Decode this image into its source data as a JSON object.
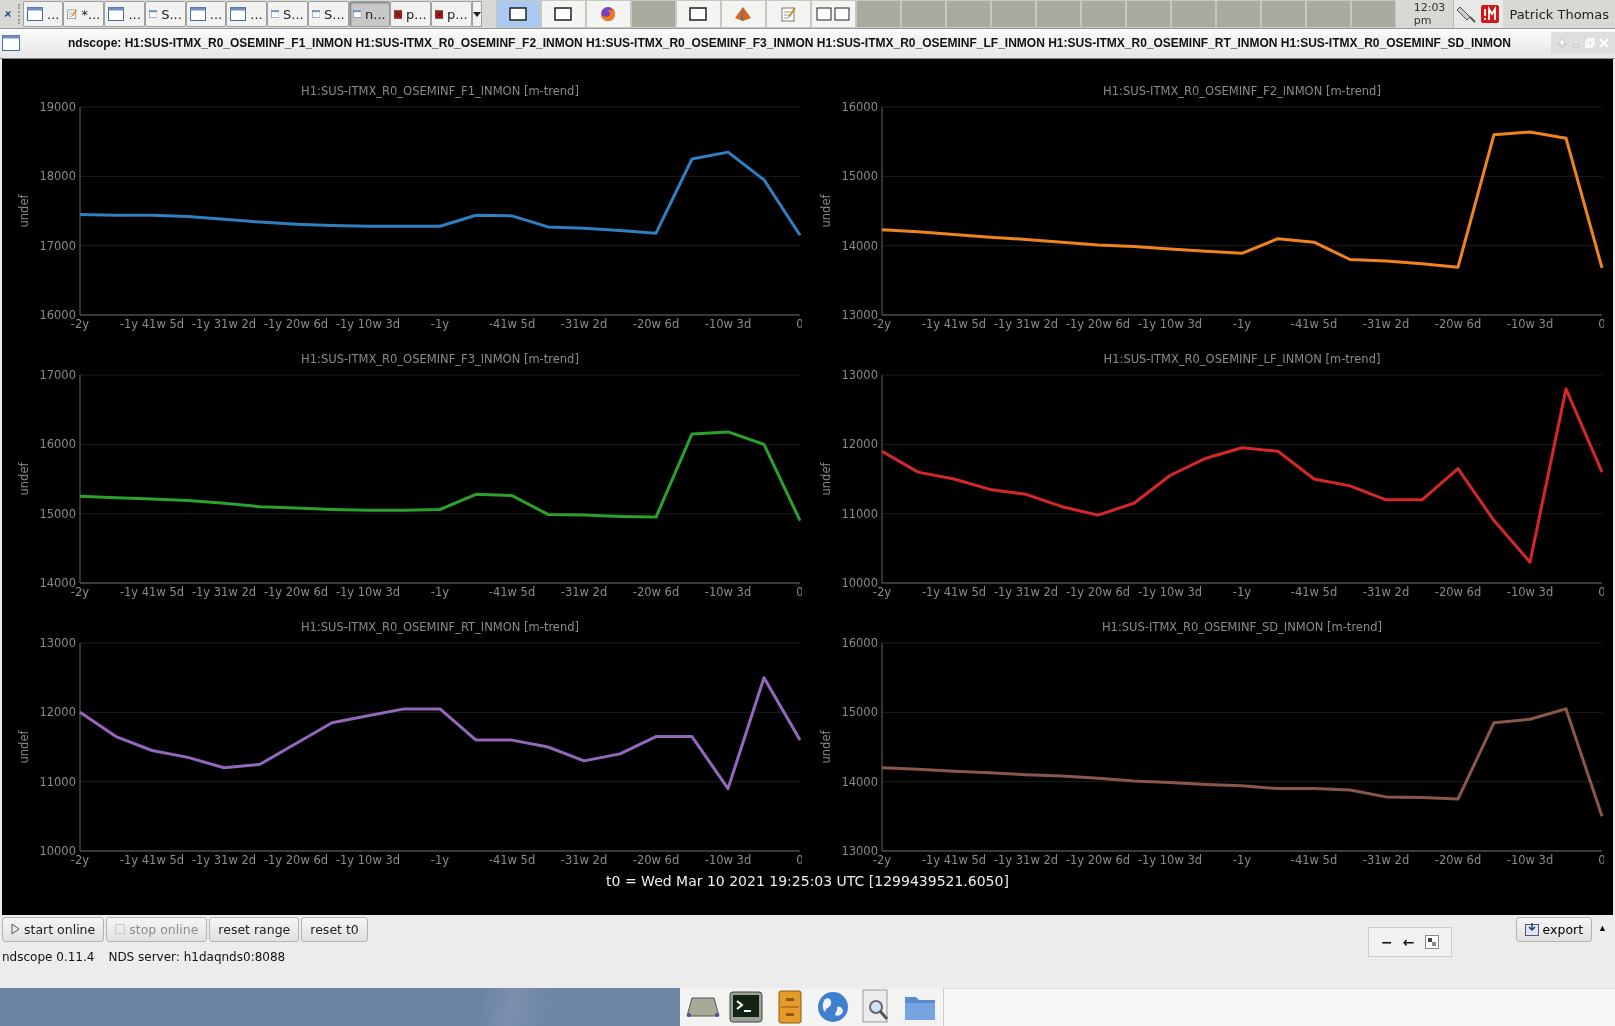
{
  "taskbar": {
    "tasks": [
      {
        "label": "...",
        "kind": "window",
        "selected": false
      },
      {
        "label": "*...",
        "kind": "editor",
        "selected": false
      },
      {
        "label": "...",
        "kind": "window",
        "selected": false
      },
      {
        "label": "S...",
        "kind": "window",
        "selected": false
      },
      {
        "label": "...",
        "kind": "window",
        "selected": false
      },
      {
        "label": "...",
        "kind": "window",
        "selected": false
      },
      {
        "label": "S...",
        "kind": "window",
        "selected": false
      },
      {
        "label": "S...",
        "kind": "window",
        "selected": false
      },
      {
        "label": "n...",
        "kind": "window",
        "selected": true
      },
      {
        "label": "p...",
        "kind": "terminal",
        "selected": false
      },
      {
        "label": "p...",
        "kind": "terminal",
        "selected": false
      }
    ],
    "workspaces": [
      {
        "kind": "window",
        "selected": true
      },
      {
        "kind": "window",
        "selected": false
      },
      {
        "kind": "browser",
        "selected": false
      },
      {
        "kind": "empty",
        "selected": false
      },
      {
        "kind": "window",
        "selected": false
      },
      {
        "kind": "cone",
        "selected": false
      },
      {
        "kind": "editor",
        "selected": false
      },
      {
        "kind": "two-windows",
        "selected": false
      },
      {
        "kind": "empty",
        "selected": false
      },
      {
        "kind": "empty",
        "selected": false
      },
      {
        "kind": "empty",
        "selected": false
      },
      {
        "kind": "empty",
        "selected": false
      },
      {
        "kind": "empty",
        "selected": false
      },
      {
        "kind": "empty",
        "selected": false
      },
      {
        "kind": "empty",
        "selected": false
      },
      {
        "kind": "empty",
        "selected": false
      },
      {
        "kind": "empty",
        "selected": false
      },
      {
        "kind": "empty",
        "selected": false
      },
      {
        "kind": "empty",
        "selected": false
      },
      {
        "kind": "empty",
        "selected": false
      }
    ],
    "clock": "12:03 pm",
    "user": "Patrick Thomas"
  },
  "window": {
    "title": "ndscope: H1:SUS-ITMX_R0_OSEMINF_F1_INMON H1:SUS-ITMX_R0_OSEMINF_F2_INMON H1:SUS-ITMX_R0_OSEMINF_F3_INMON H1:SUS-ITMX_R0_OSEMINF_LF_INMON H1:SUS-ITMX_R0_OSEMINF_RT_INMON H1:SUS-ITMX_R0_OSEMINF_SD_INMON"
  },
  "plots": [
    {
      "chart_data": {
        "type": "line",
        "title": "H1:SUS-ITMX_R0_OSEMINF_F1_INMON [m-trend]",
        "ylabel": "undef",
        "categories": [
          "-2y",
          null,
          "-1y 41w 5d",
          null,
          "-1y 31w 2d",
          null,
          "-1y 20w 6d",
          null,
          "-1y 10w 3d",
          null,
          "-1y",
          null,
          "-41w 5d",
          null,
          "-31w 2d",
          null,
          "-20w 6d",
          null,
          "-10w 3d",
          null,
          "0"
        ],
        "ylim": [
          16000,
          19000
        ],
        "yticks": [
          16000,
          17000,
          18000,
          19000
        ],
        "series": [
          {
            "color": "#2f7fc1",
            "values": [
              17450,
              17440,
              17440,
              17420,
              17380,
              17340,
              17310,
              17290,
              17280,
              17280,
              17280,
              17440,
              17430,
              17270,
              17250,
              17220,
              17180,
              18250,
              18350,
              17950,
              17150
            ]
          }
        ]
      }
    },
    {
      "chart_data": {
        "type": "line",
        "title": "H1:SUS-ITMX_R0_OSEMINF_F2_INMON [m-trend]",
        "ylabel": "undef",
        "categories": [
          "-2y",
          null,
          "-1y 41w 5d",
          null,
          "-1y 31w 2d",
          null,
          "-1y 20w 6d",
          null,
          "-1y 10w 3d",
          null,
          "-1y",
          null,
          "-41w 5d",
          null,
          "-31w 2d",
          null,
          "-20w 6d",
          null,
          "-10w 3d",
          null,
          "0"
        ],
        "ylim": [
          13000,
          16000
        ],
        "yticks": [
          13000,
          14000,
          15000,
          16000
        ],
        "series": [
          {
            "color": "#f0841c",
            "values": [
              14230,
              14200,
              14160,
              14120,
              14090,
              14050,
              14010,
              13990,
              13950,
              13920,
              13890,
              14100,
              14050,
              13800,
              13780,
              13740,
              13690,
              15600,
              15640,
              15550,
              13680
            ]
          }
        ]
      }
    },
    {
      "chart_data": {
        "type": "line",
        "title": "H1:SUS-ITMX_R0_OSEMINF_F3_INMON [m-trend]",
        "ylabel": "undef",
        "categories": [
          "-2y",
          null,
          "-1y 41w 5d",
          null,
          "-1y 31w 2d",
          null,
          "-1y 20w 6d",
          null,
          "-1y 10w 3d",
          null,
          "-1y",
          null,
          "-41w 5d",
          null,
          "-31w 2d",
          null,
          "-20w 6d",
          null,
          "-10w 3d",
          null,
          "0"
        ],
        "ylim": [
          14000,
          17000
        ],
        "yticks": [
          14000,
          15000,
          16000,
          17000
        ],
        "series": [
          {
            "color": "#2ca02c",
            "values": [
              15250,
              15230,
              15210,
              15190,
              15150,
              15100,
              15080,
              15060,
              15050,
              15050,
              15060,
              15280,
              15260,
              14990,
              14980,
              14960,
              14950,
              16150,
              16180,
              16000,
              14900
            ]
          }
        ]
      }
    },
    {
      "chart_data": {
        "type": "line",
        "title": "H1:SUS-ITMX_R0_OSEMINF_LF_INMON [m-trend]",
        "ylabel": "undef",
        "categories": [
          "-2y",
          null,
          "-1y 41w 5d",
          null,
          "-1y 31w 2d",
          null,
          "-1y 20w 6d",
          null,
          "-1y 10w 3d",
          null,
          "-1y",
          null,
          "-41w 5d",
          null,
          "-31w 2d",
          null,
          "-20w 6d",
          null,
          "-10w 3d",
          null,
          "0"
        ],
        "ylim": [
          10000,
          13000
        ],
        "yticks": [
          10000,
          11000,
          12000,
          13000
        ],
        "series": [
          {
            "color": "#d62728",
            "values": [
              11900,
              11600,
              11500,
              11350,
              11280,
              11100,
              10980,
              11150,
              11550,
              11800,
              11950,
              11900,
              11500,
              11400,
              11200,
              11200,
              11650,
              10900,
              10300,
              12800,
              11600
            ]
          }
        ]
      }
    },
    {
      "chart_data": {
        "type": "line",
        "title": "H1:SUS-ITMX_R0_OSEMINF_RT_INMON [m-trend]",
        "ylabel": "undef",
        "categories": [
          "-2y",
          null,
          "-1y 41w 5d",
          null,
          "-1y 31w 2d",
          null,
          "-1y 20w 6d",
          null,
          "-1y 10w 3d",
          null,
          "-1y",
          null,
          "-41w 5d",
          null,
          "-31w 2d",
          null,
          "-20w 6d",
          null,
          "-10w 3d",
          null,
          "0"
        ],
        "ylim": [
          10000,
          13000
        ],
        "yticks": [
          10000,
          11000,
          12000,
          13000
        ],
        "series": [
          {
            "color": "#9467bd",
            "values": [
              12000,
              11650,
              11450,
              11350,
              11200,
              11250,
              11550,
              11850,
              11950,
              12050,
              12050,
              11600,
              11600,
              11500,
              11300,
              11400,
              11650,
              11650,
              10900,
              12500,
              11600
            ]
          }
        ]
      }
    },
    {
      "chart_data": {
        "type": "line",
        "title": "H1:SUS-ITMX_R0_OSEMINF_SD_INMON [m-trend]",
        "ylabel": "undef",
        "categories": [
          "-2y",
          null,
          "-1y 41w 5d",
          null,
          "-1y 31w 2d",
          null,
          "-1y 20w 6d",
          null,
          "-1y 10w 3d",
          null,
          "-1y",
          null,
          "-41w 5d",
          null,
          "-31w 2d",
          null,
          "-20w 6d",
          null,
          "-10w 3d",
          null,
          "0"
        ],
        "ylim": [
          13000,
          16000
        ],
        "yticks": [
          13000,
          14000,
          15000,
          16000
        ],
        "series": [
          {
            "color": "#8c564b",
            "values": [
              14200,
              14180,
              14150,
              14130,
              14100,
              14080,
              14050,
              14010,
              13990,
              13960,
              13940,
              13900,
              13900,
              13880,
              13780,
              13770,
              13750,
              14850,
              14900,
              15050,
              13500
            ]
          }
        ]
      }
    }
  ],
  "t0": "t0 = Wed Mar 10 2021 19:25:03 UTC [1299439521.6050]",
  "controls": {
    "buttons": [
      {
        "label": "start online",
        "kind": "play",
        "disabled": false
      },
      {
        "label": "stop online",
        "kind": "stop",
        "disabled": true
      },
      {
        "label": "reset range",
        "kind": "plain",
        "disabled": false
      },
      {
        "label": "reset t0",
        "kind": "plain",
        "disabled": false
      }
    ],
    "zoom_tools": [
      {
        "label": "−"
      },
      {
        "label": "←"
      }
    ],
    "export": "export",
    "collapse": "▲"
  },
  "status": {
    "version": "ndscope 0.11.4",
    "server": "NDS server: h1daqnds0:8088"
  },
  "panel": {
    "launchers": [
      {
        "kind": "drive"
      },
      {
        "kind": "terminal"
      },
      {
        "kind": "cabinet"
      },
      {
        "kind": "globe"
      },
      {
        "kind": "viewer"
      },
      {
        "kind": "folder"
      }
    ]
  }
}
